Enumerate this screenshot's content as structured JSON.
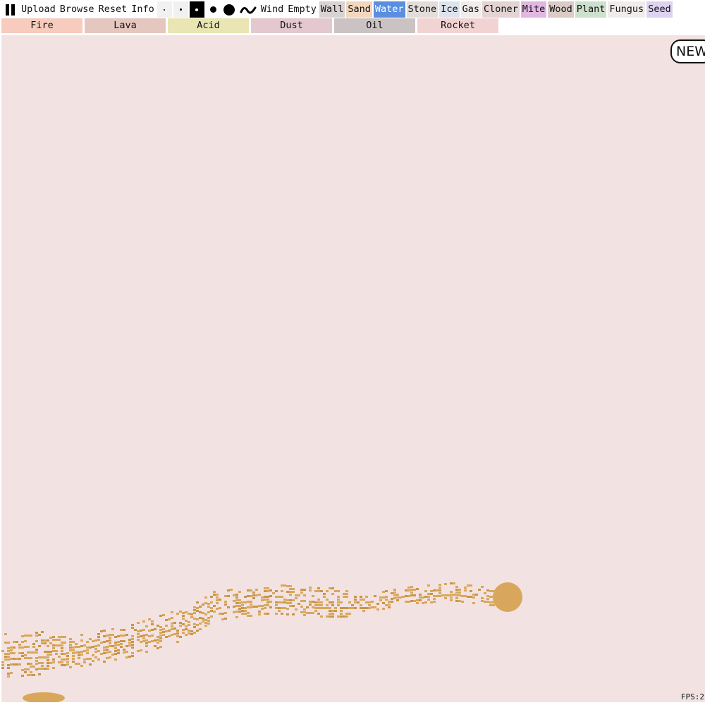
{
  "toolbar": {
    "upload": "Upload",
    "browse": "Browse",
    "reset": "Reset",
    "info": "Info",
    "selected_brush_size": 3,
    "selected_element": "Water"
  },
  "elements_row1": [
    {
      "label": "Wind",
      "color": "#ffffff"
    },
    {
      "label": "Empty",
      "color": "#ffffff"
    },
    {
      "label": "Wall",
      "color": "#d9d2d2"
    },
    {
      "label": "Sand",
      "color": "#f3d7bd"
    },
    {
      "label": "Water",
      "color": "#5a8fe0"
    },
    {
      "label": "Stone",
      "color": "#e2dddb"
    },
    {
      "label": "Ice",
      "color": "#dde4ee"
    },
    {
      "label": "Gas",
      "color": "#f1ecec"
    },
    {
      "label": "Cloner",
      "color": "#e3d3d3"
    },
    {
      "label": "Mite",
      "color": "#e1b7e2"
    },
    {
      "label": "Wood",
      "color": "#dbcbc7"
    },
    {
      "label": "Plant",
      "color": "#cde0cd"
    },
    {
      "label": "Fungus",
      "color": "#f1ecec"
    },
    {
      "label": "Seed",
      "color": "#ddd2f0"
    }
  ],
  "elements_row2": [
    {
      "label": "Fire",
      "color": "#f7cbbd"
    },
    {
      "label": "Lava",
      "color": "#e6c7c0"
    },
    {
      "label": "Acid",
      "color": "#e9e6b4"
    },
    {
      "label": "Dust",
      "color": "#e3c8cf"
    },
    {
      "label": "Oil",
      "color": "#cbc3c3"
    },
    {
      "label": "Rocket",
      "color": "#f1d3d3"
    }
  ],
  "new_badge": "NEW",
  "fps": "FPS:2",
  "colors": {
    "canvas_bg": "#f2e3e2",
    "sand": "#d9a75c",
    "sand_dark": "#c9954a",
    "selected": "#5a8fe0"
  }
}
